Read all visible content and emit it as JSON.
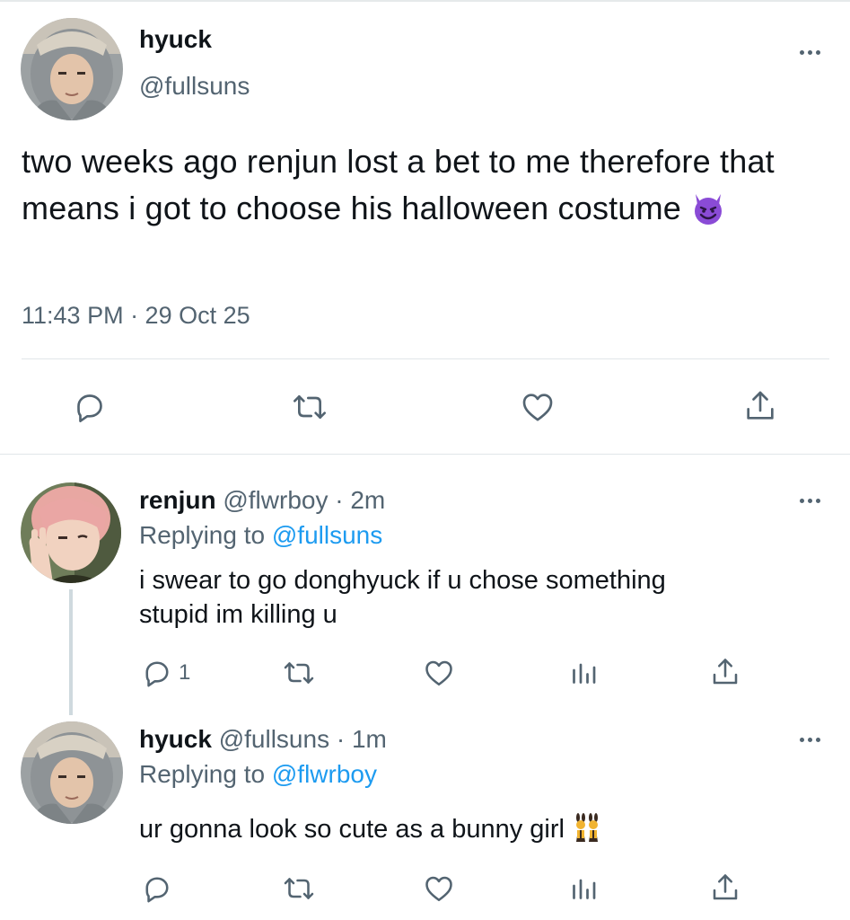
{
  "main_tweet": {
    "display_name": "hyuck",
    "handle": "@fullsuns",
    "text": "two weeks ago renjun lost a bet to me therefore that means i got to choose his halloween costume",
    "emoji": "smiling-face-with-horns",
    "timestamp": "11:43 PM · 29 Oct 25"
  },
  "replies": [
    {
      "display_name": "renjun",
      "meta": "@flwrboy · 2m",
      "replying_prefix": "Replying to ",
      "replying_to": "@fullsuns",
      "text_line1": "i swear to go donghyuck if u chose something",
      "text_line2": "stupid im killing u",
      "reply_count": "1"
    },
    {
      "display_name": "hyuck",
      "meta": "@fullsuns · 1m",
      "replying_prefix": "Replying to ",
      "replying_to": "@flwrboy",
      "text": "ur gonna look so cute as a bunny girl",
      "emoji": "women-with-bunny-ears"
    }
  ],
  "icons": [
    "reply-icon",
    "retweet-icon",
    "like-icon",
    "share-icon",
    "analytics-icon",
    "more-icon"
  ],
  "colors": {
    "accent": "#1d9bf0",
    "secondary_text": "#536471",
    "devil_emoji": "#8a4bd6",
    "thread_line": "#cfd9de"
  }
}
